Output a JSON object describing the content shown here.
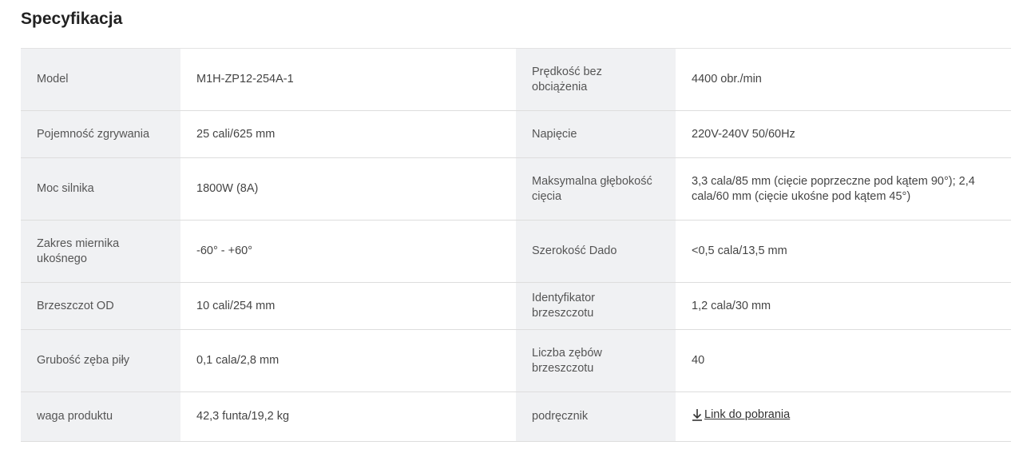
{
  "page": {
    "title": "Specyfikacja"
  },
  "spec_rows": [
    {
      "label1": "Model",
      "value1": "M1H-ZP12-254A-1",
      "label2": "Prędkość bez obciążenia",
      "value2": "4400 obr./min"
    },
    {
      "label1": "Pojemność zgrywania",
      "value1": "25 cali/625 mm",
      "label2": "Napięcie",
      "value2": "220V-240V 50/60Hz"
    },
    {
      "label1": "Moc silnika",
      "value1": "1800W (8A)",
      "label2": "Maksymalna głębokość cięcia",
      "value2": "3,3 cala/85 mm (cięcie poprzeczne pod kątem 90°); 2,4 cala/60 mm (cięcie ukośne pod kątem 45°)"
    },
    {
      "label1": "Zakres miernika ukośnego",
      "value1": "-60° - +60°",
      "label2": "Szerokość Dado",
      "value2": "<0,5 cala/13,5 mm"
    },
    {
      "label1": "Brzeszczot OD",
      "value1": "10 cali/254 mm",
      "label2": "Identyfikator brzeszczotu",
      "value2": "1,2 cala/30 mm"
    },
    {
      "label1": "Grubość zęba piły",
      "value1": "0,1 cala/2,8 mm",
      "label2": "Liczba zębów brzeszczotu",
      "value2": "40"
    },
    {
      "label1": "waga produktu",
      "value1": "42,3 funta/19,2 kg",
      "label2": "podręcznik",
      "value2": "Link do pobrania",
      "value2_icon": "download-icon"
    }
  ]
}
